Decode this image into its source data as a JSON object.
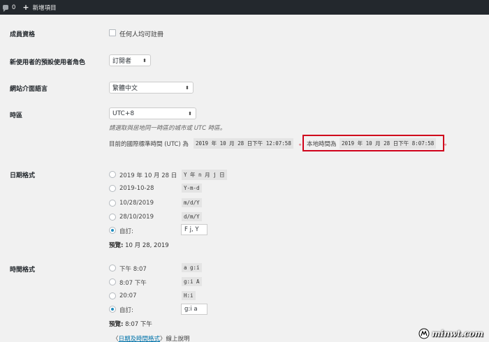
{
  "admin_bar": {
    "comments_count": "0",
    "new_label": "新增項目"
  },
  "membership": {
    "label": "成員資格",
    "checkbox_label": "任何人均可註冊"
  },
  "default_role": {
    "label": "新使用者的預設使用者角色",
    "value": "訂閱者"
  },
  "site_language": {
    "label": "網站介面語言",
    "value": "繁體中文"
  },
  "timezone": {
    "label": "時區",
    "value": "UTC+8",
    "description": "請選取與居地同一時區的城市或 UTC 時區。",
    "utc_prefix": "目前的國際標準時間 (UTC) 為",
    "utc_time": "2019 年 10 月 28 日下午 12:07:58",
    "dot1": "。",
    "local_prefix": "本地時間為",
    "local_time": "2019 年 10 月 28 日下午 8:07:58",
    "dot2": "。",
    "highlight_color": "#d0021b"
  },
  "date_format": {
    "label": "日期格式",
    "options": [
      {
        "label": "2019 年 10 月 28 日",
        "code": "Y 年 n 月 j 日"
      },
      {
        "label": "2019-10-28",
        "code": "Y-m-d"
      },
      {
        "label": "10/28/2019",
        "code": "m/d/Y"
      },
      {
        "label": "28/10/2019",
        "code": "d/m/Y"
      }
    ],
    "custom_label": "自訂:",
    "custom_value": "F j, Y",
    "preview_label": "預覽:",
    "preview_value": "10 月 28, 2019"
  },
  "time_format": {
    "label": "時間格式",
    "options": [
      {
        "label": "下午 8:07",
        "code": "a g:i"
      },
      {
        "label": "8:07 下午",
        "code": "g:i A"
      },
      {
        "label": "20:07",
        "code": "H:i"
      }
    ],
    "custom_label": "自訂:",
    "custom_value": "g:i a",
    "preview_label": "預覽:",
    "preview_value": "8:07 下午"
  },
  "docs": {
    "open": "〈",
    "link": "日期及時間格式",
    "close": "〉線上說明"
  },
  "watermark": {
    "text": "minwt.com"
  }
}
